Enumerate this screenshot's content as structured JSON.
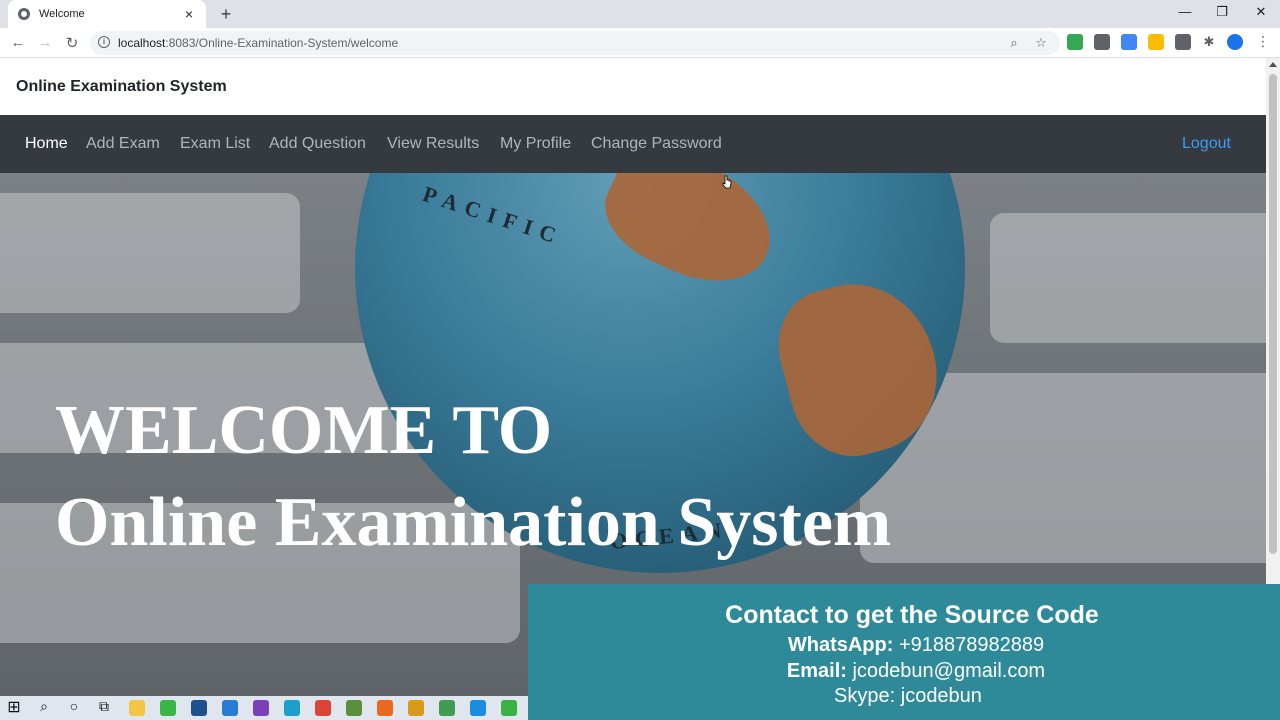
{
  "browser": {
    "tab_title": "Welcome",
    "tab_close": "×",
    "new_tab": "+",
    "window_controls": {
      "minimize": "—",
      "maximize": "❐",
      "close": "✕"
    },
    "nav": {
      "back": "←",
      "forward": "→",
      "reload": "↻"
    },
    "url_host": "localhost",
    "url_rest": ":8083/Online-Examination-System/welcome",
    "zoom_icon": "⌕",
    "star_icon": "☆",
    "extensions_icon": "✱",
    "menu_icon": "⋮",
    "extension_colors": [
      "#34a853",
      "#5f6368",
      "#4285f4",
      "#fbbc04",
      "#5f6368",
      "#1a73e8"
    ]
  },
  "site": {
    "brand": "Online Examination System",
    "nav": [
      {
        "label": "Home",
        "active": true
      },
      {
        "label": "Add Exam",
        "active": false
      },
      {
        "label": "Exam List",
        "active": false
      },
      {
        "label": "Add Question",
        "active": false
      },
      {
        "label": "View Results",
        "active": false
      },
      {
        "label": "My Profile",
        "active": false
      },
      {
        "label": "Change Password",
        "active": false
      }
    ],
    "logout": "Logout",
    "colors": {
      "navbar": "#343a40",
      "logout": "#3d9bf5",
      "promo": "#2e8a99"
    }
  },
  "hero": {
    "line1": "WELCOME TO",
    "line2": "Online Examination System",
    "globe_labels": [
      "PACIFIC",
      "OCEAN"
    ]
  },
  "promo": {
    "heading": "Contact to get the Source Code",
    "whatsapp_label": "WhatsApp:",
    "whatsapp_value": " +918878982889",
    "email_label": "Email:",
    "email_value": " jcodebun@gmail.com",
    "skype": "Skype: jcodebun"
  },
  "taskbar": {
    "start": "⊞",
    "search": "⌕",
    "cortana": "○",
    "task_view": "⧉",
    "app_colors": [
      "#f2c744",
      "#3ab54a",
      "#1e4f8f",
      "#2a7bd4",
      "#7b3fb8",
      "#1aa0c8",
      "#db4437",
      "#5a8f3c",
      "#e96a1f",
      "#d89a1a",
      "#3f9c52",
      "#1b8de0",
      "#3bb143"
    ]
  }
}
